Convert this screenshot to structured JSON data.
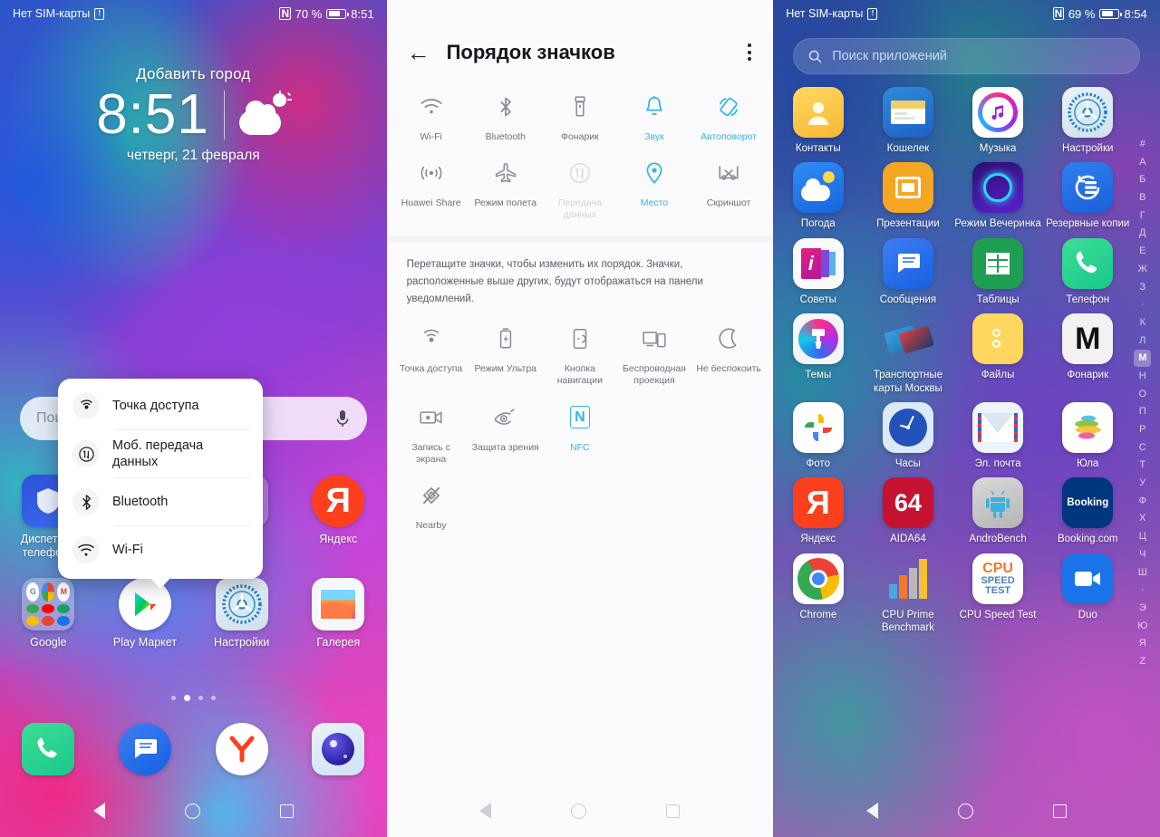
{
  "home": {
    "statusbar": {
      "sim": "Нет SIM-карты",
      "nfc": "N",
      "battery": "70 %",
      "time": "8:51"
    },
    "weather": {
      "city": "Добавить город",
      "time": "8:51",
      "date": "четверг, 21 февраля",
      "icon": "partly-cloudy-icon"
    },
    "search": {
      "placeholder": "Поиск",
      "mic_icon": "microphone-icon"
    },
    "popup": {
      "items": [
        {
          "label": "Точка доступа",
          "icon": "hotspot-icon"
        },
        {
          "label": "Моб. передача данных",
          "icon": "mobile-data-icon"
        },
        {
          "label": "Bluetooth",
          "icon": "bluetooth-icon"
        },
        {
          "label": "Wi-Fi",
          "icon": "wifi-icon"
        }
      ]
    },
    "row1": [
      {
        "label": "Диспетчер телефона",
        "icon": "phone-manager-icon"
      },
      {
        "label": "",
        "icon": "hidden-icon"
      },
      {
        "label": "",
        "icon": "hidden-icon"
      },
      {
        "label": "Яндекс",
        "icon": "yandex-icon"
      }
    ],
    "row2": [
      {
        "label": "Google",
        "icon": "google-folder-icon"
      },
      {
        "label": "Play Маркет",
        "icon": "play-store-icon"
      },
      {
        "label": "Настройки",
        "icon": "settings-icon"
      },
      {
        "label": "Галерея",
        "icon": "gallery-icon"
      }
    ],
    "pages": {
      "count": 4,
      "active": 2
    },
    "dock": [
      {
        "label": "",
        "icon": "phone-icon"
      },
      {
        "label": "",
        "icon": "messages-icon"
      },
      {
        "label": "",
        "icon": "yandex-browser-icon"
      },
      {
        "label": "",
        "icon": "camera-icon"
      }
    ],
    "navbar": {
      "back": "back-icon",
      "home": "home-icon",
      "recents": "recents-icon"
    }
  },
  "settings": {
    "header": {
      "back_icon": "arrow-left-icon",
      "title": "Порядок значков",
      "menu_icon": "overflow-menu-icon"
    },
    "hint": "Перетащите значки, чтобы изменить их порядок. Значки, расположенные выше других, будут отображаться на панели уведомлений.",
    "accent": "#33b5e8",
    "toggles_top": [
      {
        "label": "Wi-Fi",
        "icon": "wifi-icon",
        "state": "normal"
      },
      {
        "label": "Bluetooth",
        "icon": "bluetooth-icon",
        "state": "normal"
      },
      {
        "label": "Фонарик",
        "icon": "flashlight-icon",
        "state": "normal"
      },
      {
        "label": "Звук",
        "icon": "sound-bell-icon",
        "state": "on"
      },
      {
        "label": "Автоповорот",
        "icon": "auto-rotate-icon",
        "state": "on"
      },
      {
        "label": "Huawei Share",
        "icon": "huawei-share-icon",
        "state": "normal"
      },
      {
        "label": "Режим полета",
        "icon": "airplane-icon",
        "state": "normal"
      },
      {
        "label": "Передача данных",
        "icon": "mobile-data-icon",
        "state": "off"
      },
      {
        "label": "Место",
        "icon": "location-pin-icon",
        "state": "on"
      },
      {
        "label": "Скриншот",
        "icon": "screenshot-icon",
        "state": "normal"
      }
    ],
    "toggles_bottom": [
      {
        "label": "Точка доступа",
        "icon": "hotspot-icon",
        "state": "normal"
      },
      {
        "label": "Режим Ультра",
        "icon": "ultra-battery-icon",
        "state": "normal"
      },
      {
        "label": "Кнопка навигации",
        "icon": "nav-button-icon",
        "state": "normal"
      },
      {
        "label": "Беспроводная проекция",
        "icon": "wireless-projection-icon",
        "state": "normal"
      },
      {
        "label": "Не беспокоить",
        "icon": "do-not-disturb-moon-icon",
        "state": "normal"
      },
      {
        "label": "Запись с экрана",
        "icon": "screen-record-icon",
        "state": "normal"
      },
      {
        "label": "Защита зрения",
        "icon": "eye-comfort-icon",
        "state": "normal"
      },
      {
        "label": "NFC",
        "icon": "nfc-icon",
        "state": "on"
      },
      {
        "label": "",
        "icon": "",
        "state": "empty"
      },
      {
        "label": "",
        "icon": "",
        "state": "empty"
      },
      {
        "label": "Nearby",
        "icon": "nearby-off-icon",
        "state": "normal"
      }
    ],
    "navbar": {
      "back": "back-icon",
      "home": "home-icon",
      "recents": "recents-icon"
    }
  },
  "drawer": {
    "statusbar": {
      "sim": "Нет SIM-карты",
      "nfc": "N",
      "battery": "69 %",
      "time": "8:54"
    },
    "search": {
      "placeholder": "Поиск приложений",
      "icon": "search-icon"
    },
    "apps": [
      {
        "label": "Контакты",
        "icon": "contacts-icon"
      },
      {
        "label": "Кошелек",
        "icon": "wallet-icon"
      },
      {
        "label": "Музыка",
        "icon": "music-icon"
      },
      {
        "label": "Настройки",
        "icon": "settings-icon"
      },
      {
        "label": "Погода",
        "icon": "weather-icon"
      },
      {
        "label": "Презентации",
        "icon": "slides-icon"
      },
      {
        "label": "Режим Вечеринка",
        "icon": "party-mode-icon"
      },
      {
        "label": "Резервные копии",
        "icon": "backup-icon"
      },
      {
        "label": "Советы",
        "icon": "tips-icon"
      },
      {
        "label": "Сообщения",
        "icon": "messages-icon"
      },
      {
        "label": "Таблицы",
        "icon": "sheets-icon"
      },
      {
        "label": "Телефон",
        "icon": "phone-icon"
      },
      {
        "label": "Темы",
        "icon": "themes-icon"
      },
      {
        "label": "Транспортные карты Москвы",
        "icon": "transport-cards-icon"
      },
      {
        "label": "Файлы",
        "icon": "files-icon"
      },
      {
        "label": "Фонарик",
        "icon": "flashlight-m-icon"
      },
      {
        "label": "Фото",
        "icon": "google-photos-icon"
      },
      {
        "label": "Часы",
        "icon": "clock-icon"
      },
      {
        "label": "Эл. почта",
        "icon": "email-icon"
      },
      {
        "label": "Юла",
        "icon": "yula-icon"
      },
      {
        "label": "Яндекс",
        "icon": "yandex-icon"
      },
      {
        "label": "AIDA64",
        "icon": "aida64-icon"
      },
      {
        "label": "AndroBench",
        "icon": "androbench-icon"
      },
      {
        "label": "Booking.com",
        "icon": "booking-icon"
      },
      {
        "label": "Chrome",
        "icon": "chrome-icon"
      },
      {
        "label": "CPU Prime Benchmark",
        "icon": "cpu-prime-icon"
      },
      {
        "label": "CPU Speed Test",
        "icon": "cpu-speed-icon"
      },
      {
        "label": "Duo",
        "icon": "duo-icon"
      }
    ],
    "index": [
      "#",
      "А",
      "Б",
      "В",
      "Г",
      "Д",
      "Е",
      "Ж",
      "З",
      "·",
      "К",
      "Л",
      "М",
      "Н",
      "О",
      "П",
      "Р",
      "С",
      "Т",
      "У",
      "Ф",
      "Х",
      "Ц",
      "Ч",
      "Ш",
      "·",
      "Э",
      "Ю",
      "Я",
      "Z"
    ],
    "index_selected": "М",
    "navbar": {
      "back": "back-icon",
      "home": "home-icon",
      "recents": "recents-icon"
    }
  }
}
